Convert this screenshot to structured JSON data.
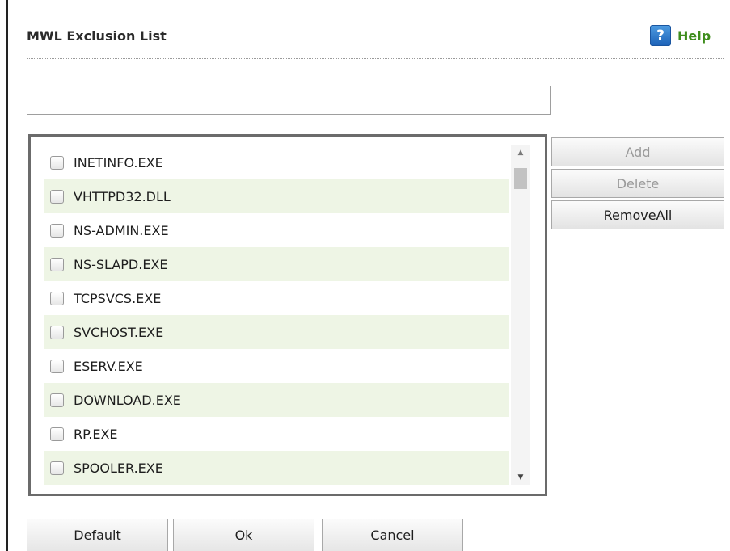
{
  "dialog": {
    "title": "MWL Exclusion List"
  },
  "help": {
    "icon": "help-icon",
    "icon_glyph": "?",
    "label": "Help"
  },
  "entry": {
    "value": "",
    "placeholder": ""
  },
  "list": {
    "items": [
      {
        "label": "INETINFO.EXE",
        "checked": false
      },
      {
        "label": "VHTTPD32.DLL",
        "checked": false
      },
      {
        "label": "NS-ADMIN.EXE",
        "checked": false
      },
      {
        "label": "NS-SLAPD.EXE",
        "checked": false
      },
      {
        "label": "TCPSVCS.EXE",
        "checked": false
      },
      {
        "label": "SVCHOST.EXE",
        "checked": false
      },
      {
        "label": "ESERV.EXE",
        "checked": false
      },
      {
        "label": "DOWNLOAD.EXE",
        "checked": false
      },
      {
        "label": "RP.EXE",
        "checked": false
      },
      {
        "label": "SPOOLER.EXE",
        "checked": false
      }
    ],
    "scroll_up_glyph": "▲",
    "scroll_down_glyph": "▼",
    "alt_row_color": "#eef5e5"
  },
  "actions": {
    "add_label": "Add",
    "add_enabled": false,
    "delete_label": "Delete",
    "delete_enabled": false,
    "remove_all_label": "RemoveAll",
    "remove_all_enabled": true
  },
  "footer": {
    "default_label": "Default",
    "ok_label": "Ok",
    "cancel_label": "Cancel"
  },
  "colors": {
    "help_accent": "#3e8d1c",
    "help_icon_bg": "#2f7fd0"
  }
}
